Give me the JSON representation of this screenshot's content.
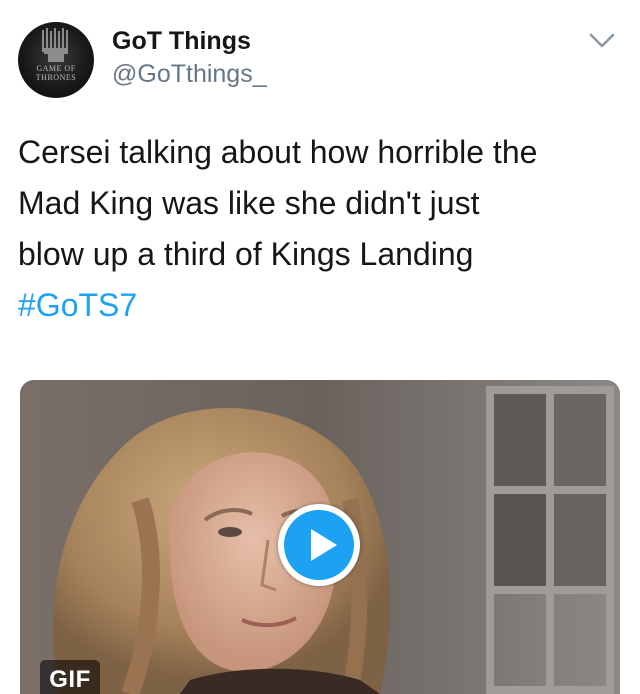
{
  "user": {
    "display_name": "GoT Things",
    "handle": "@GoTthings_",
    "avatar_logo_text": "GAME OF THRONES"
  },
  "tweet": {
    "text_lines": [
      "Cersei talking about how horrible the",
      "Mad King was like she didn't just",
      "blow up a third of Kings Landing"
    ],
    "hashtag": "#GoTS7"
  },
  "media": {
    "badge": "GIF",
    "play_icon": "play-icon"
  },
  "icons": {
    "menu": "chevron-down-icon",
    "avatar": "iron-throne-icon"
  },
  "colors": {
    "link": "#1da1f2",
    "handle": "#657786",
    "text": "#14171a"
  }
}
